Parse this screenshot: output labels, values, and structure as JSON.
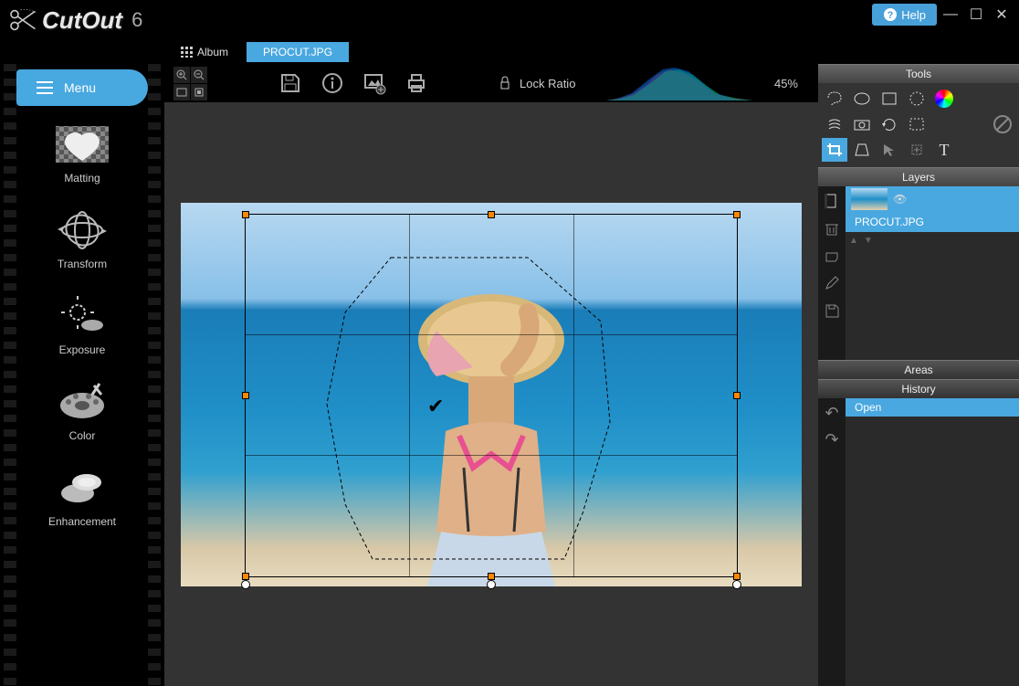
{
  "app": {
    "title": "CutOut",
    "version": "6"
  },
  "titlebar": {
    "help": "Help"
  },
  "tabs": {
    "album": "Album",
    "active_file": "PROCUT.JPG"
  },
  "sidebar": {
    "menu": "Menu",
    "items": [
      {
        "label": "Matting"
      },
      {
        "label": "Transform"
      },
      {
        "label": "Exposure"
      },
      {
        "label": "Color"
      },
      {
        "label": "Enhancement"
      }
    ]
  },
  "toolbar": {
    "lock_ratio": "Lock Ratio",
    "zoom": "45%"
  },
  "panels": {
    "tools_title": "Tools",
    "layers_title": "Layers",
    "areas_title": "Areas",
    "history_title": "History"
  },
  "layers": [
    {
      "name": "PROCUT.JPG",
      "visible": true
    }
  ],
  "history": [
    {
      "label": "Open"
    }
  ]
}
